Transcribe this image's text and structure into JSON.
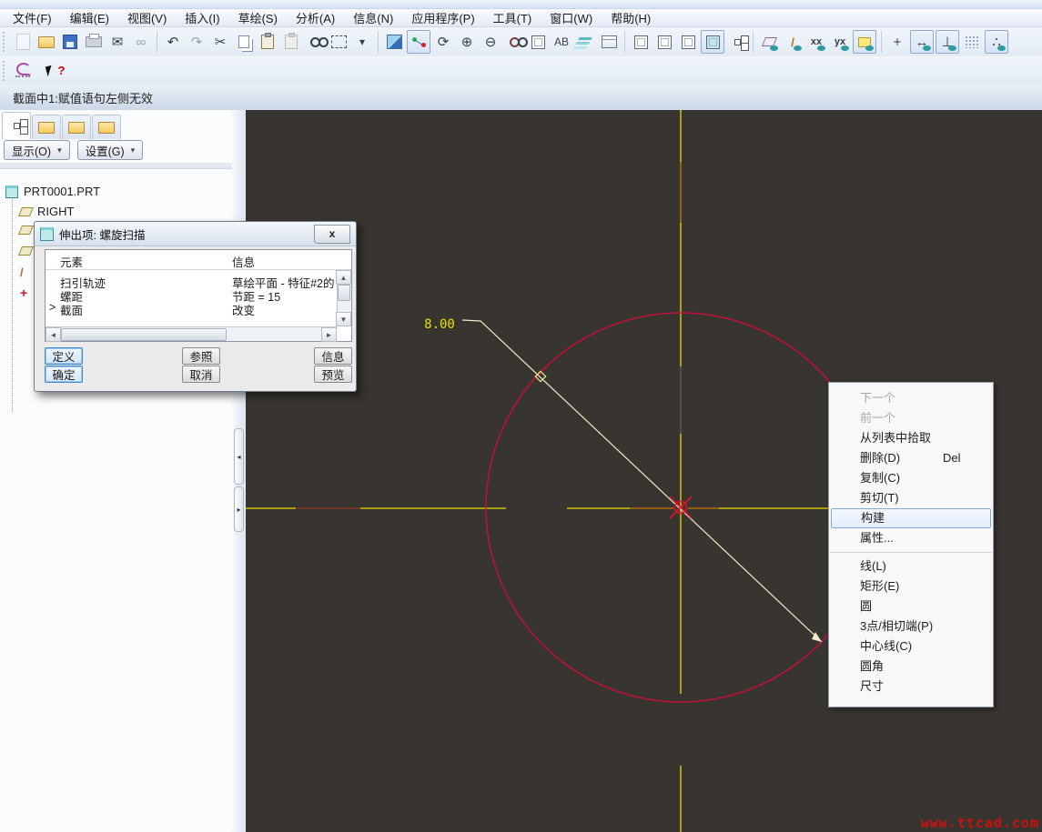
{
  "menu_bar": {
    "items": [
      "文件(F)",
      "编辑(E)",
      "视图(V)",
      "插入(I)",
      "草绘(S)",
      "分析(A)",
      "信息(N)",
      "应用程序(P)",
      "工具(T)",
      "窗口(W)",
      "帮助(H)"
    ]
  },
  "toolbar": {
    "glyphs": {
      "undo": "↶",
      "redo": "↷",
      "cut": "✂",
      "mail": "✉",
      "zoom_in": "⊕",
      "zoom_out": "⊖",
      "refresh": "⟳",
      "caret": "▾",
      "ab": "AB",
      "link": "∞",
      "orient": "↘",
      "points": "xx",
      "csys": "yx",
      "dim": "↔",
      "constraint": "⊥",
      "vertex": "∴",
      "spin": "+",
      "help": "?"
    },
    "icon_names": [
      "new-file",
      "open-file",
      "save",
      "print",
      "send-mail",
      "link",
      "undo",
      "redo",
      "cut",
      "copy",
      "paste",
      "paste-special",
      "find",
      "select-box",
      "repaint",
      "highlight-links",
      "refresh",
      "zoom-in",
      "zoom-out",
      "refit",
      "view-orient",
      "annotate-ab",
      "layers",
      "tree-table",
      "wireframe",
      "hidden-line",
      "no-hidden",
      "shading",
      "model-tree",
      "datum-planes",
      "datum-axes",
      "point-symbols",
      "coordinate-systems",
      "notes",
      "spin-center",
      "dimension-display",
      "constraint-display",
      "grid-display",
      "vertex-display",
      "sketcher-tools",
      "context-help"
    ]
  },
  "message_bar": {
    "text": "截面中1:赋值语句左侧无效"
  },
  "navigator": {
    "show_button": "显示(O)",
    "settings_button": "设置(G)",
    "tree": {
      "root": "PRT0001.PRT",
      "visible_items": [
        "RIGHT"
      ]
    }
  },
  "dialog": {
    "title": "伸出项: 螺旋扫描",
    "close_label": "x",
    "row_marker": ">",
    "table": {
      "headers": [
        "元素",
        "信息"
      ],
      "rows": [
        [
          "扫引轨迹",
          "草绘平面 - 特征#2的"
        ],
        [
          "螺距",
          "节距 = 15"
        ],
        [
          "截面",
          "改变"
        ]
      ]
    },
    "buttons": {
      "define": "定义",
      "refs": "参照",
      "info": "信息",
      "ok": "确定",
      "cancel": "取消",
      "preview": "预览"
    }
  },
  "canvas": {
    "dimension_label": "8.00",
    "watermark": "www.ttcad.com",
    "background": "#38342f",
    "circle_color": "#c41038",
    "centerline_color": "#e8e000",
    "entities": [
      "circle",
      "vertical-centerline",
      "horizontal-centerline",
      "diagonal-dimension-line",
      "center-point"
    ]
  },
  "context_menu": {
    "items": [
      {
        "label": "下一个",
        "state": "disabled"
      },
      {
        "label": "前一个",
        "state": "disabled"
      },
      {
        "label": "从列表中拾取"
      },
      {
        "label": "删除(D)",
        "shortcut": "Del"
      },
      {
        "label": "复制(C)"
      },
      {
        "label": "剪切(T)"
      },
      {
        "label": "构建",
        "state": "highlighted"
      },
      {
        "label": "属性..."
      },
      {
        "label": "线(L)"
      },
      {
        "label": "矩形(E)"
      },
      {
        "label": "圆"
      },
      {
        "label": "3点/相切端(P)"
      },
      {
        "label": "中心线(C)"
      },
      {
        "label": "圆角"
      },
      {
        "label": "尺寸"
      }
    ]
  }
}
